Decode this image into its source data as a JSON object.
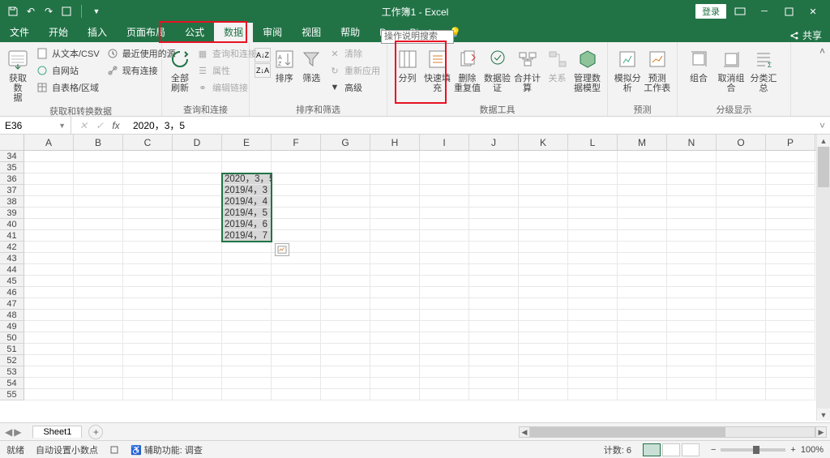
{
  "title": "工作簿1 - Excel",
  "login": "登录",
  "tabs": [
    "文件",
    "开始",
    "插入",
    "页面布局",
    "公式",
    "数据",
    "审阅",
    "视图",
    "帮助",
    "Power Pivot"
  ],
  "active_tab_index": 5,
  "search_overlay": "操作说明搜索",
  "share": "共享",
  "ribbon": {
    "g1": {
      "label": "获取和转换数据",
      "big": "获取数\n据",
      "items": [
        "从文本/CSV",
        "自网站",
        "自表格/区域",
        "最近使用的源",
        "现有连接"
      ]
    },
    "g2": {
      "label": "查询和连接",
      "big": "全部刷新",
      "items": [
        "查询和连接",
        "属性",
        "编辑链接"
      ]
    },
    "g3": {
      "label": "排序和筛选",
      "sort": "排序",
      "filter": "筛选",
      "items": [
        "清除",
        "重新应用",
        "高级"
      ]
    },
    "g4": {
      "label": "数据工具",
      "btns": [
        "分列",
        "快速填充",
        "删除\n重复值",
        "数据验\n证",
        "合并计算",
        "关系",
        "管理数\n据模型"
      ]
    },
    "g5": {
      "label": "预测",
      "btns": [
        "模拟分析",
        "预测\n工作表"
      ]
    },
    "g6": {
      "label": "分级显示",
      "btns": [
        "组合",
        "取消组合",
        "分类汇总"
      ]
    }
  },
  "namebox": "E36",
  "formula": "2020，3，5",
  "columns": [
    "A",
    "B",
    "C",
    "D",
    "E",
    "F",
    "G",
    "H",
    "I",
    "J",
    "K",
    "L",
    "M",
    "N",
    "O",
    "P"
  ],
  "row_start": 34,
  "row_end": 55,
  "cells": {
    "36": "2020，3，5",
    "37": "2019/4，3",
    "38": "2019/4，4",
    "39": "2019/4，5",
    "40": "2019/4，6",
    "41": "2019/4，7"
  },
  "sheet_tab": "Sheet1",
  "status": {
    "ready": "就绪",
    "dec": "自动设置小数点",
    "acc": "辅助功能: 调查",
    "count": "计数: 6",
    "zoom": "100%"
  }
}
